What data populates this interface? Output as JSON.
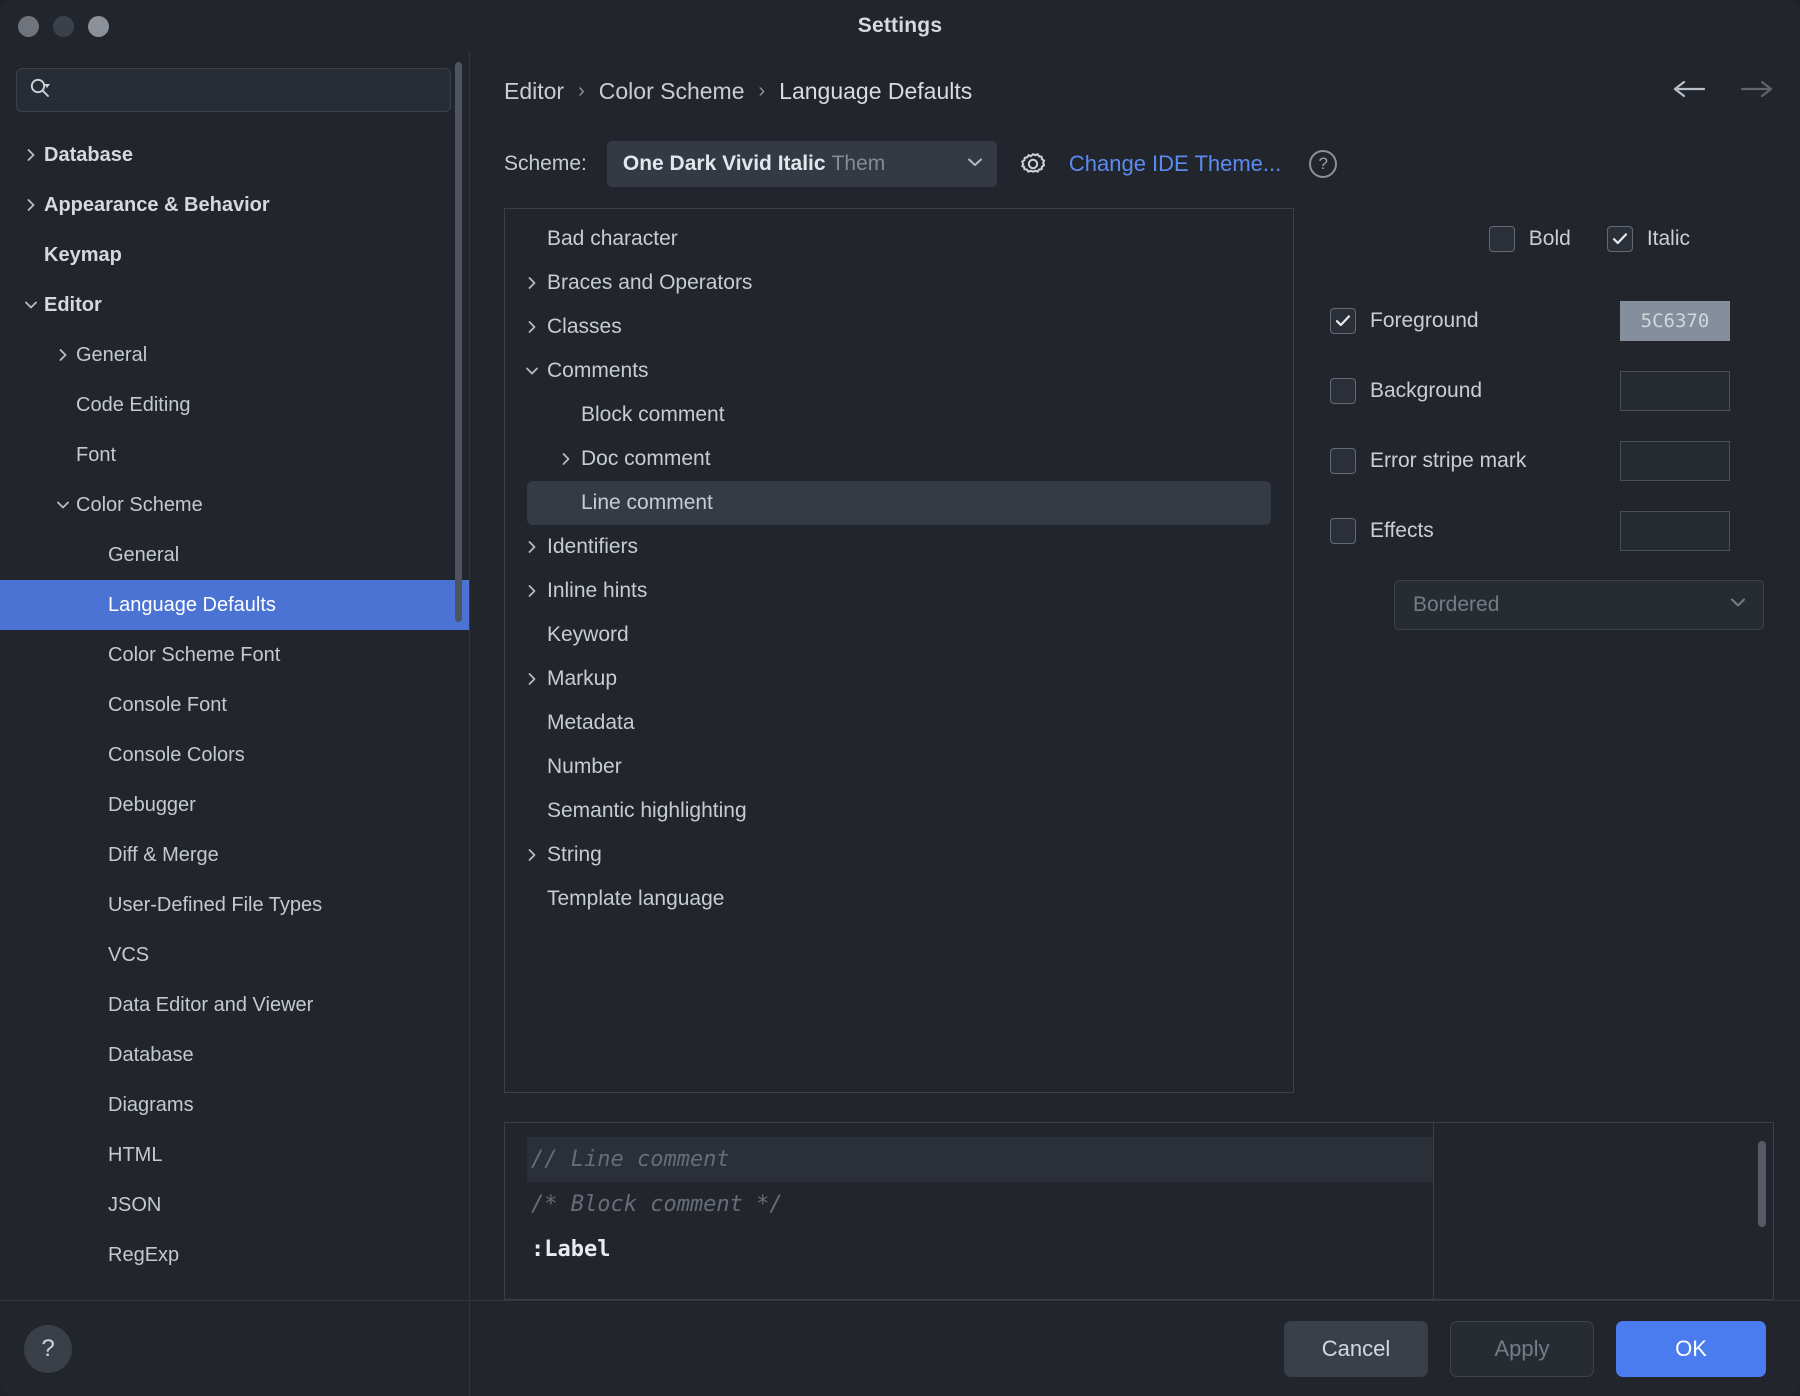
{
  "window": {
    "title": "Settings",
    "traffic_lights": [
      "close",
      "minimize",
      "zoom"
    ]
  },
  "sidebar": {
    "search": {
      "placeholder": "",
      "value": "",
      "icon": "search-icon"
    },
    "help_button_label": "?",
    "items": [
      {
        "label": "Database",
        "level": 0,
        "chevron": "right",
        "bold": true,
        "selected": false
      },
      {
        "label": "Appearance & Behavior",
        "level": 0,
        "chevron": "right",
        "bold": true,
        "selected": false
      },
      {
        "label": "Keymap",
        "level": 0,
        "chevron": "none",
        "bold": true,
        "selected": false
      },
      {
        "label": "Editor",
        "level": 0,
        "chevron": "down",
        "bold": true,
        "selected": false
      },
      {
        "label": "General",
        "level": 1,
        "chevron": "right",
        "bold": false,
        "selected": false
      },
      {
        "label": "Code Editing",
        "level": 1,
        "chevron": "none",
        "bold": false,
        "selected": false
      },
      {
        "label": "Font",
        "level": 1,
        "chevron": "none",
        "bold": false,
        "selected": false
      },
      {
        "label": "Color Scheme",
        "level": 1,
        "chevron": "down",
        "bold": false,
        "selected": false
      },
      {
        "label": "General",
        "level": 2,
        "chevron": "none",
        "bold": false,
        "selected": false
      },
      {
        "label": "Language Defaults",
        "level": 2,
        "chevron": "none",
        "bold": false,
        "selected": true
      },
      {
        "label": "Color Scheme Font",
        "level": 2,
        "chevron": "none",
        "bold": false,
        "selected": false
      },
      {
        "label": "Console Font",
        "level": 2,
        "chevron": "none",
        "bold": false,
        "selected": false
      },
      {
        "label": "Console Colors",
        "level": 2,
        "chevron": "none",
        "bold": false,
        "selected": false
      },
      {
        "label": "Debugger",
        "level": 2,
        "chevron": "none",
        "bold": false,
        "selected": false
      },
      {
        "label": "Diff & Merge",
        "level": 2,
        "chevron": "none",
        "bold": false,
        "selected": false
      },
      {
        "label": "User-Defined File Types",
        "level": 2,
        "chevron": "none",
        "bold": false,
        "selected": false
      },
      {
        "label": "VCS",
        "level": 2,
        "chevron": "none",
        "bold": false,
        "selected": false
      },
      {
        "label": "Data Editor and Viewer",
        "level": 2,
        "chevron": "none",
        "bold": false,
        "selected": false
      },
      {
        "label": "Database",
        "level": 2,
        "chevron": "none",
        "bold": false,
        "selected": false
      },
      {
        "label": "Diagrams",
        "level": 2,
        "chevron": "none",
        "bold": false,
        "selected": false
      },
      {
        "label": "HTML",
        "level": 2,
        "chevron": "none",
        "bold": false,
        "selected": false
      },
      {
        "label": "JSON",
        "level": 2,
        "chevron": "none",
        "bold": false,
        "selected": false
      },
      {
        "label": "RegExp",
        "level": 2,
        "chevron": "none",
        "bold": false,
        "selected": false
      }
    ]
  },
  "breadcrumb": {
    "separator": "›",
    "items": [
      "Editor",
      "Color Scheme",
      "Language Defaults"
    ],
    "back_icon": "arrow-left-icon",
    "forward_icon": "arrow-right-icon"
  },
  "scheme_bar": {
    "label": "Scheme:",
    "selected_name": "One Dark Vivid Italic",
    "selected_suffix": "Them",
    "gear_icon": "gear-icon",
    "change_theme_link": "Change IDE Theme...",
    "help_icon": "question-circle-icon"
  },
  "attributes_tree": [
    {
      "label": "Bad character",
      "level": 0,
      "chevron": "none",
      "selected": false
    },
    {
      "label": "Braces and Operators",
      "level": 0,
      "chevron": "right",
      "selected": false
    },
    {
      "label": "Classes",
      "level": 0,
      "chevron": "right",
      "selected": false
    },
    {
      "label": "Comments",
      "level": 0,
      "chevron": "down",
      "selected": false
    },
    {
      "label": "Block comment",
      "level": 1,
      "chevron": "none",
      "selected": false
    },
    {
      "label": "Doc comment",
      "level": 1,
      "chevron": "right",
      "selected": false
    },
    {
      "label": "Line comment",
      "level": 1,
      "chevron": "none",
      "selected": true
    },
    {
      "label": "Identifiers",
      "level": 0,
      "chevron": "right",
      "selected": false
    },
    {
      "label": "Inline hints",
      "level": 0,
      "chevron": "right",
      "selected": false
    },
    {
      "label": "Keyword",
      "level": 0,
      "chevron": "none",
      "selected": false
    },
    {
      "label": "Markup",
      "level": 0,
      "chevron": "right",
      "selected": false
    },
    {
      "label": "Metadata",
      "level": 0,
      "chevron": "none",
      "selected": false
    },
    {
      "label": "Number",
      "level": 0,
      "chevron": "none",
      "selected": false
    },
    {
      "label": "Semantic highlighting",
      "level": 0,
      "chevron": "none",
      "selected": false
    },
    {
      "label": "String",
      "level": 0,
      "chevron": "right",
      "selected": false
    },
    {
      "label": "Template language",
      "level": 0,
      "chevron": "none",
      "selected": false
    }
  ],
  "attributes_panel": {
    "font_style": [
      {
        "label": "Bold",
        "checked": false
      },
      {
        "label": "Italic",
        "checked": true
      }
    ],
    "rows": [
      {
        "label": "Foreground",
        "checked": true,
        "color_value": "5C6370",
        "color_hex": "#858e9d",
        "has_color": true
      },
      {
        "label": "Background",
        "checked": false,
        "color_value": "",
        "color_hex": "",
        "has_color": false
      },
      {
        "label": "Error stripe mark",
        "checked": false,
        "color_value": "",
        "color_hex": "",
        "has_color": false
      },
      {
        "label": "Effects",
        "checked": false,
        "color_value": "",
        "color_hex": "",
        "has_color": false
      }
    ],
    "effect_select": {
      "value": "Bordered",
      "chevron": "chevron-down-icon",
      "disabled": true
    }
  },
  "preview": {
    "lines": [
      {
        "text": "// Line comment",
        "style": "comment",
        "highlighted": true
      },
      {
        "text": "/* Block comment */",
        "style": "comment",
        "highlighted": false
      },
      {
        "text": ":Label",
        "style": "label",
        "highlighted": false
      }
    ]
  },
  "footer": {
    "buttons": [
      {
        "label": "Cancel",
        "kind": "cancel"
      },
      {
        "label": "Apply",
        "kind": "apply"
      },
      {
        "label": "OK",
        "kind": "ok"
      }
    ]
  },
  "colors": {
    "accent_blue": "#4a7cf0",
    "selection_blue": "#4a73d4",
    "link_blue": "#5b8bf0",
    "panel_bg": "#22262c"
  }
}
